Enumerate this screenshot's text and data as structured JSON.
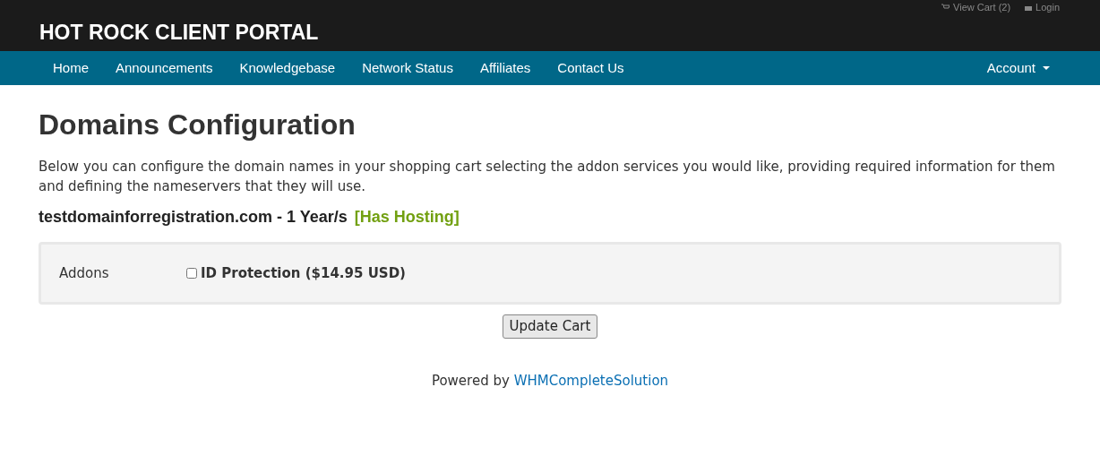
{
  "top_links": [
    {
      "kind": "cart",
      "label": "View Cart (2)"
    },
    {
      "kind": "login",
      "label": "Login"
    }
  ],
  "brand": "HOT ROCK CLIENT PORTAL",
  "nav": {
    "items": [
      "Home",
      "Announcements",
      "Knowledgebase",
      "Network Status",
      "Affiliates",
      "Contact Us"
    ],
    "account": "Account"
  },
  "heading": "Domains Configuration",
  "intro": "Below you can configure the domain names in your shopping cart selecting the addon services you would like, providing required information for them and defining the nameservers that they will use.",
  "domain": {
    "name": "testdomainforregistration.com - 1 Year/s",
    "tag": "[Has Hosting]"
  },
  "addons": {
    "label": "Addons",
    "options": [
      {
        "label": "ID Protection ($14.95 USD)",
        "checked": false
      }
    ]
  },
  "button": "Update Cart",
  "footer": {
    "prefix": "Powered by",
    "link": "WHMCompleteSolution"
  }
}
